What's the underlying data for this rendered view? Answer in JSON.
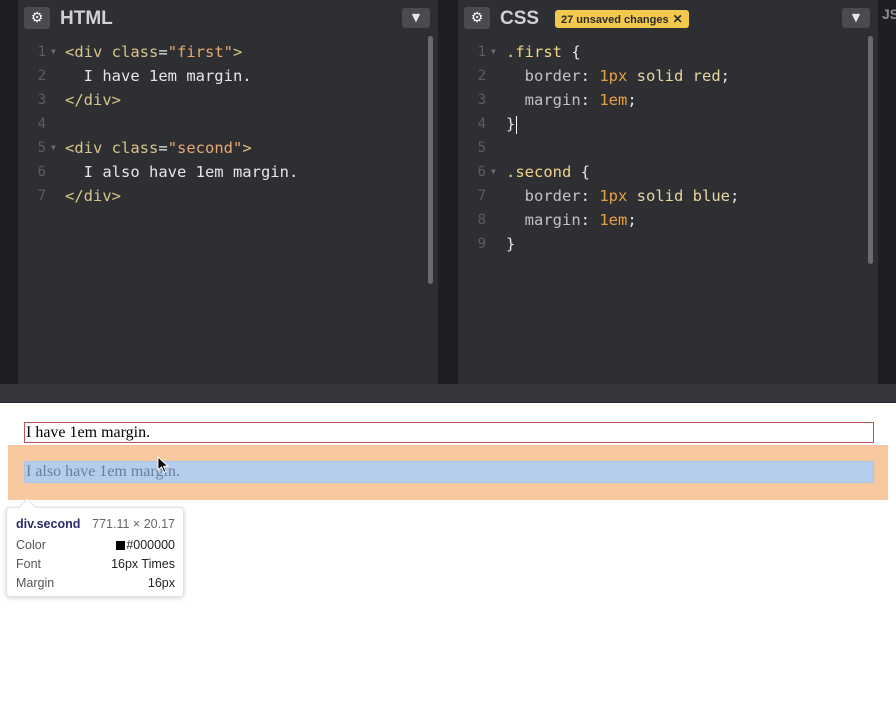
{
  "html_pane": {
    "title": "HTML",
    "lines": [
      {
        "n": "1",
        "fold": true,
        "parts": [
          {
            "c": "tag",
            "t": "<div "
          },
          {
            "c": "att",
            "t": "class"
          },
          {
            "c": "plain",
            "t": "="
          },
          {
            "c": "str",
            "t": "\"first\""
          },
          {
            "c": "tag",
            "t": ">"
          }
        ]
      },
      {
        "n": "2",
        "parts": [
          {
            "c": "plain",
            "t": "  I have 1em margin."
          }
        ]
      },
      {
        "n": "3",
        "parts": [
          {
            "c": "tag",
            "t": "</div>"
          }
        ]
      },
      {
        "n": "4",
        "parts": []
      },
      {
        "n": "5",
        "fold": true,
        "parts": [
          {
            "c": "tag",
            "t": "<div "
          },
          {
            "c": "att",
            "t": "class"
          },
          {
            "c": "plain",
            "t": "="
          },
          {
            "c": "str",
            "t": "\"second\""
          },
          {
            "c": "tag",
            "t": ">"
          }
        ]
      },
      {
        "n": "6",
        "parts": [
          {
            "c": "plain",
            "t": "  I also have 1em margin."
          }
        ]
      },
      {
        "n": "7",
        "parts": [
          {
            "c": "tag",
            "t": "</div>"
          }
        ]
      }
    ]
  },
  "css_pane": {
    "title": "CSS",
    "unsaved_badge": "27 unsaved changes",
    "lines": [
      {
        "n": "1",
        "fold": true,
        "parts": [
          {
            "c": "sel",
            "t": ".first "
          },
          {
            "c": "plain",
            "t": "{"
          }
        ]
      },
      {
        "n": "2",
        "parts": [
          {
            "c": "prop",
            "t": "  border"
          },
          {
            "c": "plain",
            "t": ": "
          },
          {
            "c": "num",
            "t": "1px"
          },
          {
            "c": "val",
            "t": " solid red"
          },
          {
            "c": "plain",
            "t": ";"
          }
        ]
      },
      {
        "n": "3",
        "parts": [
          {
            "c": "prop",
            "t": "  margin"
          },
          {
            "c": "plain",
            "t": ": "
          },
          {
            "c": "num",
            "t": "1em"
          },
          {
            "c": "plain",
            "t": ";"
          }
        ]
      },
      {
        "n": "4",
        "cursor": true,
        "parts": [
          {
            "c": "plain",
            "t": "}"
          }
        ]
      },
      {
        "n": "5",
        "parts": []
      },
      {
        "n": "6",
        "fold": true,
        "parts": [
          {
            "c": "sel",
            "t": ".second "
          },
          {
            "c": "plain",
            "t": "{"
          }
        ]
      },
      {
        "n": "7",
        "parts": [
          {
            "c": "prop",
            "t": "  border"
          },
          {
            "c": "plain",
            "t": ": "
          },
          {
            "c": "num",
            "t": "1px"
          },
          {
            "c": "val",
            "t": " solid blue"
          },
          {
            "c": "plain",
            "t": ";"
          }
        ]
      },
      {
        "n": "8",
        "parts": [
          {
            "c": "prop",
            "t": "  margin"
          },
          {
            "c": "plain",
            "t": ": "
          },
          {
            "c": "num",
            "t": "1em"
          },
          {
            "c": "plain",
            "t": ";"
          }
        ]
      },
      {
        "n": "9",
        "parts": [
          {
            "c": "plain",
            "t": "}"
          }
        ]
      }
    ]
  },
  "js_pane_edge_label": "JS",
  "preview": {
    "first_text": "I have 1em margin.",
    "second_text": "I also have 1em margin."
  },
  "inspector_tooltip": {
    "element": "div.second",
    "size": "771.11 × 20.17",
    "rows": [
      {
        "label": "Color",
        "value": "#000000",
        "swatch": "#000000"
      },
      {
        "label": "Font",
        "value": "16px Times"
      },
      {
        "label": "Margin",
        "value": "16px"
      }
    ]
  },
  "icons": {
    "gear": "gear-icon",
    "collapse": "chevron-down-icon",
    "close": "close-icon",
    "cursor": "mouse-pointer-icon"
  },
  "colors": {
    "editor_bg": "#2e2f33",
    "badge": "#f2c94c",
    "margin_highlight": "#f8c9a0",
    "element_highlight": "#b4cdea"
  }
}
